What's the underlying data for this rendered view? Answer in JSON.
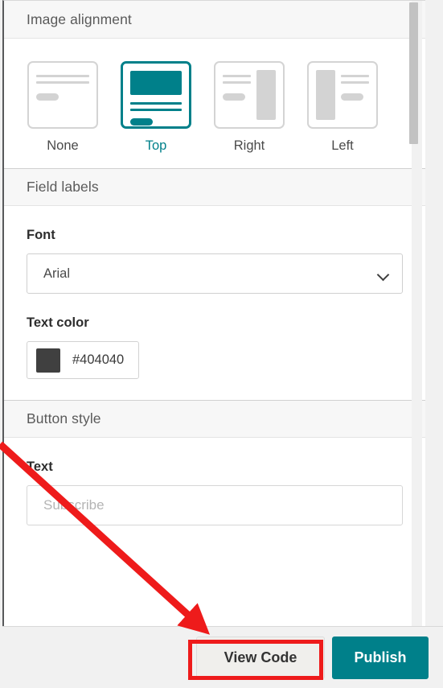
{
  "panel": {
    "sections": [
      {
        "id": "image-alignment",
        "title": "Image alignment",
        "options": [
          {
            "label": "None",
            "value": "none",
            "selected": false
          },
          {
            "label": "Top",
            "value": "top",
            "selected": true
          },
          {
            "label": "Right",
            "value": "right",
            "selected": false
          },
          {
            "label": "Left",
            "value": "left",
            "selected": false
          }
        ]
      },
      {
        "id": "field-labels",
        "title": "Field labels",
        "font": {
          "label": "Font",
          "value": "Arial",
          "icon": "chevron-down-icon"
        },
        "text_color": {
          "label": "Text color",
          "value": "#404040",
          "swatch": "#404040"
        }
      },
      {
        "id": "button-style",
        "title": "Button style",
        "text": {
          "label": "Text",
          "value": "",
          "placeholder": "Subscribe"
        }
      }
    ]
  },
  "footer": {
    "view_code_label": "View Code",
    "publish_label": "Publish"
  },
  "annotation": {
    "arrow_color": "#ee1b1b",
    "highlight_color": "#ee1b1b",
    "highlight_target": "View Code"
  },
  "theme": {
    "accent": "#00808a",
    "panel_bg": "#ffffff",
    "header_bg": "#f7f7f7",
    "footer_bg": "#f1f1f1"
  }
}
